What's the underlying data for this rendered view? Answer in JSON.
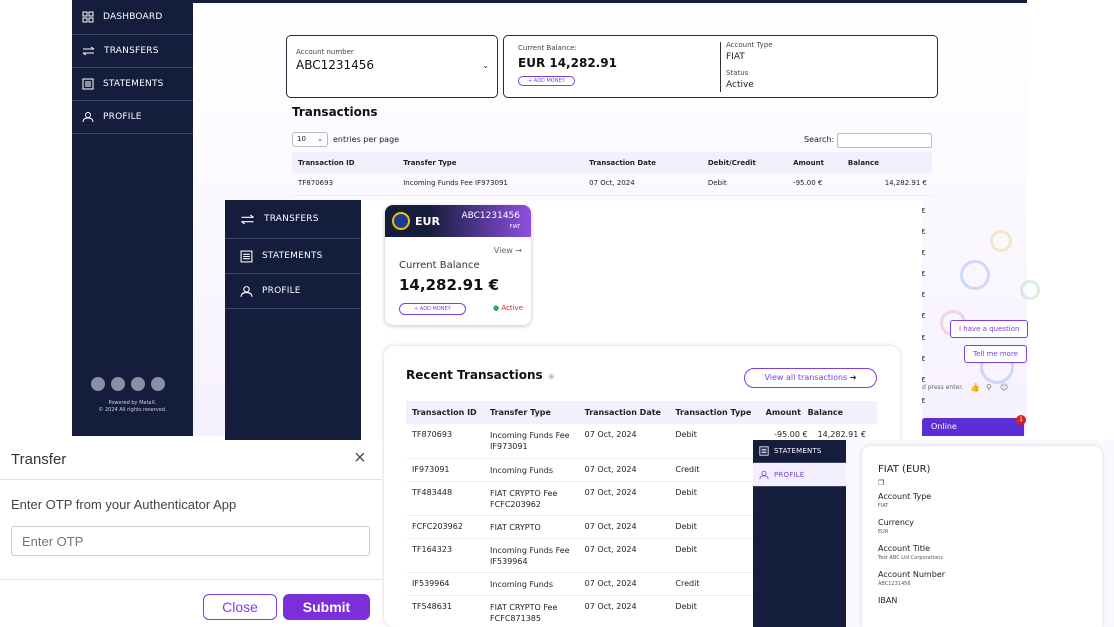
{
  "colors": {
    "navy": "#141d3c",
    "purple": "#7b3fe4",
    "header_bg": "#f4efff"
  },
  "bg_window": {
    "sidebar": [
      {
        "label": "DASHBOARD",
        "icon": "dashboard-icon"
      },
      {
        "label": "TRANSFERS",
        "icon": "transfers-icon"
      },
      {
        "label": "STATEMENTS",
        "icon": "statements-icon"
      },
      {
        "label": "PROFILE",
        "icon": "profile-icon"
      }
    ],
    "footer": {
      "powered": "Powered by MetaX.",
      "rights": "© 2024 All rights reserved."
    },
    "account": {
      "label": "Account number",
      "value": "ABC1231456"
    },
    "balance": {
      "label": "Current Balance:",
      "value": "EUR 14,282.91",
      "add": "+ ADD MONEY",
      "type_label": "Account Type",
      "type_value": "FIAT",
      "status_label": "Status",
      "status_value": "Active"
    },
    "title": "Transactions",
    "entries": {
      "value": "10",
      "suffix": "entries per page",
      "search": "Search:"
    },
    "headers": [
      "Transaction ID",
      "Transfer Type",
      "Transaction Date",
      "Debit/Credit",
      "Amount",
      "Balance"
    ],
    "row": [
      "TF870693",
      "Incoming Funds Fee IF973091",
      "07 Oct, 2024",
      "Debit",
      "-95.00 €",
      "14,282.91 €"
    ],
    "euro_col": [
      "€",
      "€",
      "€",
      "€",
      "€",
      "€",
      "€",
      "€",
      "€",
      "€"
    ]
  },
  "mid_window": {
    "sidebar": [
      {
        "label": "TRANSFERS",
        "icon": "transfers-icon"
      },
      {
        "label": "STATEMENTS",
        "icon": "statements-icon"
      },
      {
        "label": "PROFILE",
        "icon": "profile-icon"
      }
    ],
    "card": {
      "currency": "EUR",
      "account": "ABC1231456",
      "type": "FIAT",
      "view": "View",
      "balance_label": "Current Balance",
      "balance": "14,282.91 €",
      "add": "+ ADD MONEY",
      "status": "Active"
    },
    "recent": {
      "title": "Recent Transactions",
      "view_all": "View all transactions",
      "headers": [
        "Transaction ID",
        "Transfer Type",
        "Transaction Date",
        "Transaction Type",
        "Amount",
        "Balance"
      ],
      "rows": [
        {
          "id": "TF870693",
          "type1": "Incoming Funds Fee",
          "type2": "IF973091",
          "date": "07 Oct, 2024",
          "tt": "Debit",
          "amount": "-95.00 €",
          "balance": "14,282.91 €"
        },
        {
          "id": "IF973091",
          "type1": "Incoming Funds",
          "type2": "",
          "date": "07 Oct, 2024",
          "tt": "Credit",
          "amount": "",
          "balance": ""
        },
        {
          "id": "TF483448",
          "type1": "FIAT CRYPTO Fee",
          "type2": "FCFC203962",
          "date": "07 Oct, 2024",
          "tt": "Debit",
          "amount": "",
          "balance": ""
        },
        {
          "id": "FCFC203962",
          "type1": "FIAT CRYPTO",
          "type2": "",
          "date": "07 Oct, 2024",
          "tt": "Debit",
          "amount": "",
          "balance": ""
        },
        {
          "id": "TF164323",
          "type1": "Incoming Funds Fee",
          "type2": "IF539964",
          "date": "07 Oct, 2024",
          "tt": "Debit",
          "amount": "",
          "balance": ""
        },
        {
          "id": "IF539964",
          "type1": "Incoming Funds",
          "type2": "",
          "date": "07 Oct, 2024",
          "tt": "Credit",
          "amount": "",
          "balance": ""
        },
        {
          "id": "TF548631",
          "type1": "FIAT CRYPTO Fee",
          "type2": "FCFC871385",
          "date": "07 Oct, 2024",
          "tt": "Debit",
          "amount": "",
          "balance": ""
        }
      ]
    }
  },
  "chat": {
    "q1": "I have a question",
    "q2": "Tell me more",
    "input": "d press enter.",
    "online": "Online",
    "badge": "1"
  },
  "modal": {
    "title": "Transfer",
    "label": "Enter OTP from your Authenticator App",
    "placeholder": "Enter OTP",
    "close": "Close",
    "submit": "Submit"
  },
  "right_window": {
    "sidebar": [
      {
        "label": "STATEMENTS",
        "icon": "statements-icon"
      },
      {
        "label": "PROFILE",
        "icon": "profile-icon"
      }
    ],
    "title": "FIAT (EUR)",
    "fields": [
      {
        "label": "Account Type",
        "value": "FIAT"
      },
      {
        "label": "Currency",
        "value": "EUR"
      },
      {
        "label": "Account Title",
        "value": "Test ABC Ltd Corporations"
      },
      {
        "label": "Account Number",
        "value": "ABC1231456"
      },
      {
        "label": "IBAN",
        "value": ""
      }
    ]
  }
}
